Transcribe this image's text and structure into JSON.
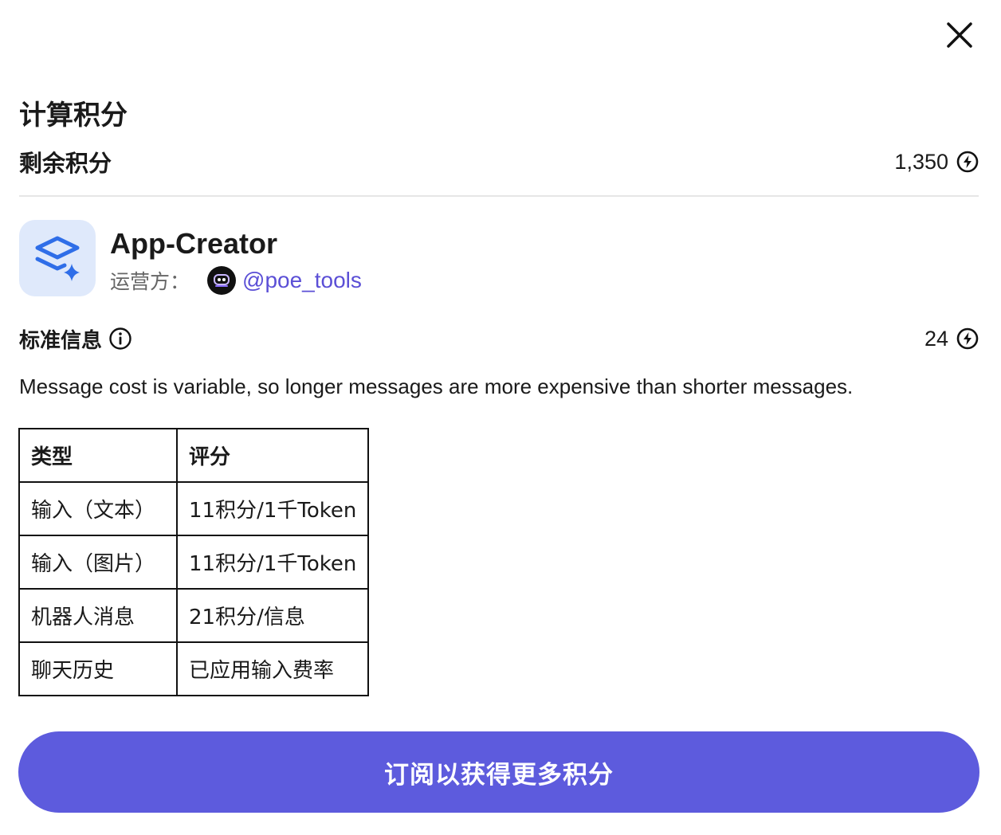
{
  "dialog": {
    "title": "计算积分",
    "close_icon": "close-icon"
  },
  "balance": {
    "label": "剩余积分",
    "value": "1,350",
    "icon": "lightning-icon"
  },
  "bot": {
    "name": "App-Creator",
    "icon": "layers-sparkle-icon",
    "operator_label": "运营方：",
    "operator_handle": "@poe_tools"
  },
  "standard": {
    "label": "标准信息",
    "info_icon": "info-icon",
    "value": "24",
    "icon": "lightning-icon"
  },
  "description": "Message cost is variable, so longer messages are more expensive than shorter messages.",
  "table": {
    "headers": [
      "类型",
      "评分"
    ],
    "rows": [
      [
        "输入（文本）",
        "11积分/1千Token"
      ],
      [
        "输入（图片）",
        "11积分/1千Token"
      ],
      [
        "机器人消息",
        "21积分/信息"
      ],
      [
        "聊天历史",
        "已应用输入费率"
      ]
    ]
  },
  "subscribe_button": "订阅以获得更多积分",
  "colors": {
    "accent": "#5d5bdd",
    "link": "#5b4fd6",
    "avatar_bg": "#dfe9fb",
    "bot_icon": "#2f6ee8"
  }
}
